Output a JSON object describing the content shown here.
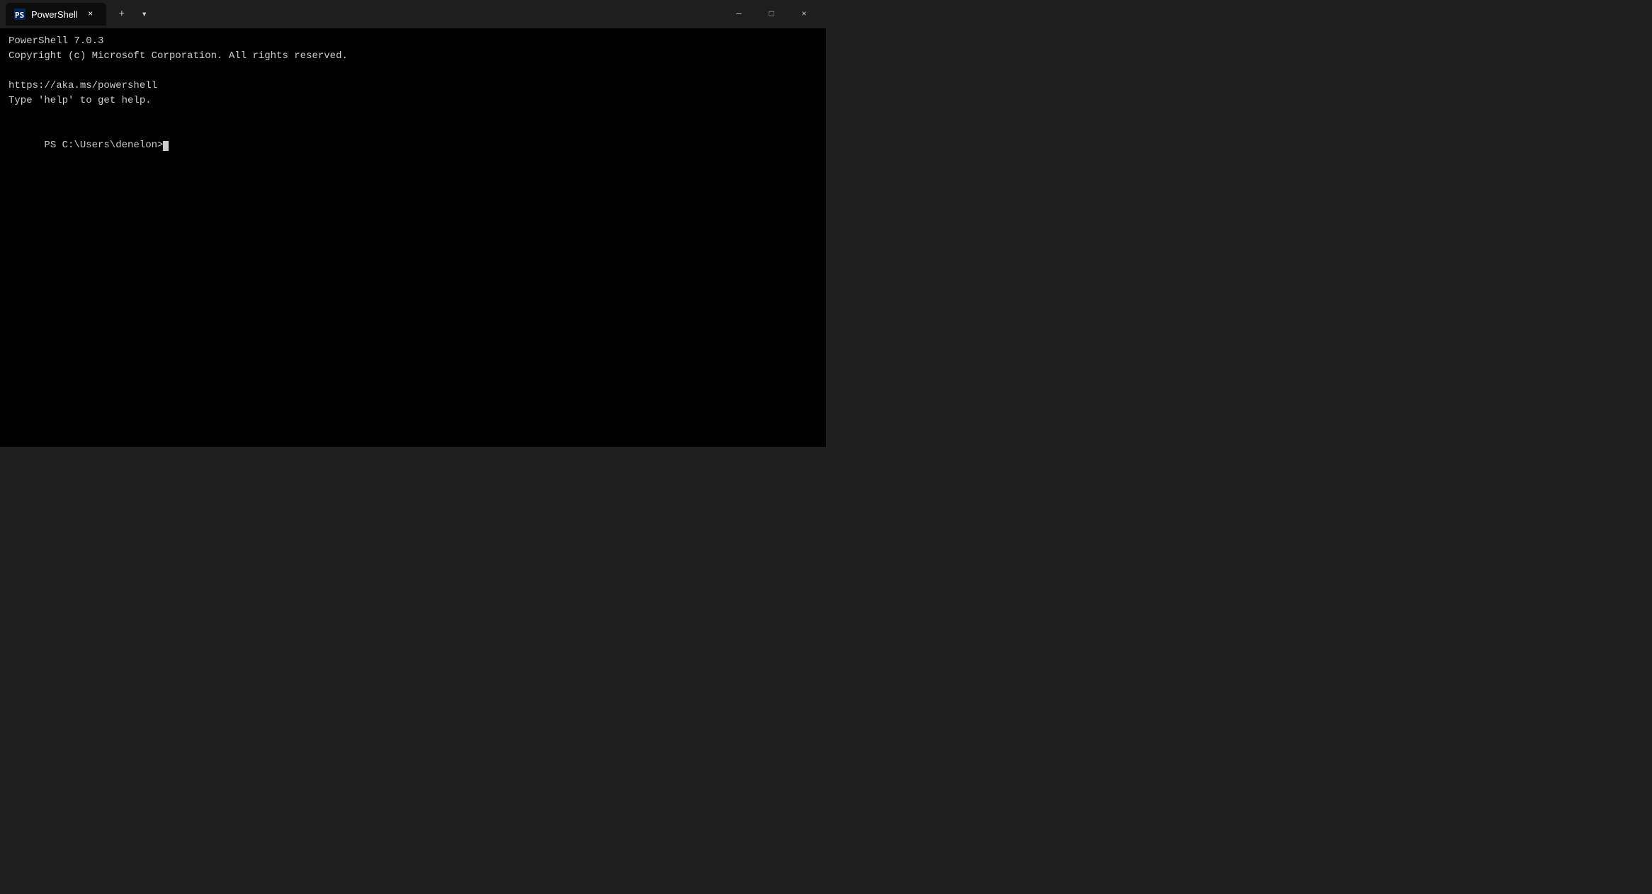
{
  "titlebar": {
    "tab_title": "PowerShell",
    "close_label": "×",
    "new_tab_label": "+",
    "dropdown_label": "▾",
    "minimize_label": "─",
    "maximize_label": "□",
    "window_close_label": "×"
  },
  "terminal": {
    "line1": "PowerShell 7.0.3",
    "line2": "Copyright (c) Microsoft Corporation. All rights reserved.",
    "line3": "",
    "line4": "https://aka.ms/powershell",
    "line5": "Type 'help' to get help.",
    "line6": "",
    "prompt": "PS C:\\Users\\denelon>"
  },
  "colors": {
    "titlebar_bg": "#1e1e1e",
    "terminal_bg": "#000000",
    "text_color": "#cccccc",
    "tab_bg": "#0c0c0c"
  }
}
